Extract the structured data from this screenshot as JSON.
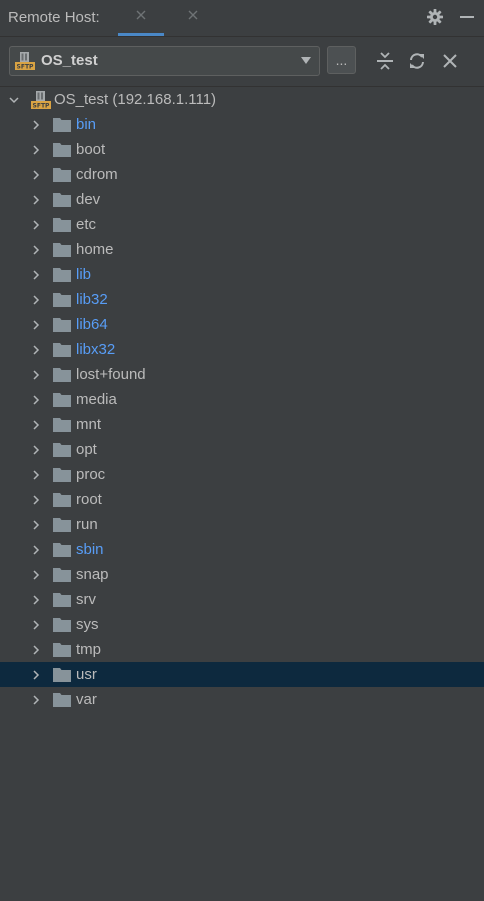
{
  "header": {
    "title": "Remote Host:",
    "tabs": [
      {
        "name": "tab-1",
        "active": true
      },
      {
        "name": "tab-2",
        "active": false
      }
    ],
    "icons": [
      "gear-icon",
      "minimize-icon"
    ]
  },
  "toolbar": {
    "connection": "OS_test",
    "browse_label": "...",
    "icons": [
      "collapse-all-icon",
      "refresh-icon",
      "close-icon"
    ]
  },
  "tree": {
    "root": "OS_test (192.168.1.111)",
    "items": [
      {
        "label": "bin",
        "link": true
      },
      {
        "label": "boot",
        "link": false
      },
      {
        "label": "cdrom",
        "link": false
      },
      {
        "label": "dev",
        "link": false
      },
      {
        "label": "etc",
        "link": false
      },
      {
        "label": "home",
        "link": false
      },
      {
        "label": "lib",
        "link": true
      },
      {
        "label": "lib32",
        "link": true
      },
      {
        "label": "lib64",
        "link": true
      },
      {
        "label": "libx32",
        "link": true
      },
      {
        "label": "lost+found",
        "link": false
      },
      {
        "label": "media",
        "link": false
      },
      {
        "label": "mnt",
        "link": false
      },
      {
        "label": "opt",
        "link": false
      },
      {
        "label": "proc",
        "link": false
      },
      {
        "label": "root",
        "link": false
      },
      {
        "label": "run",
        "link": false
      },
      {
        "label": "sbin",
        "link": true
      },
      {
        "label": "snap",
        "link": false
      },
      {
        "label": "srv",
        "link": false
      },
      {
        "label": "sys",
        "link": false
      },
      {
        "label": "tmp",
        "link": false
      },
      {
        "label": "usr",
        "link": false,
        "selected": true
      },
      {
        "label": "var",
        "link": false
      }
    ]
  },
  "colors": {
    "background": "#3c3f41",
    "text": "#bbbbbb",
    "link_text": "#589df6",
    "selection": "#0d293e",
    "folder": "#87939a",
    "sftp_badge": "#d9a343"
  }
}
